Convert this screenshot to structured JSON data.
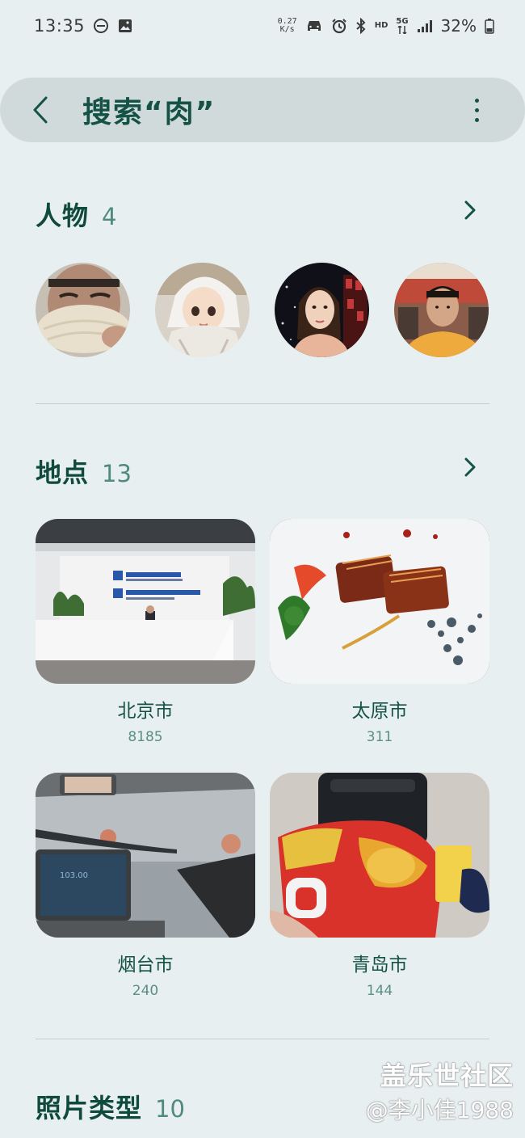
{
  "status_bar": {
    "time": "13:35",
    "net_speed_value": "0.27",
    "net_speed_unit": "K/s",
    "hd_label": "HD",
    "network_label": "5G",
    "battery": "32%",
    "icons": [
      "do-not-disturb-icon",
      "gallery-icon",
      "car-icon",
      "alarm-icon",
      "bluetooth-icon",
      "signal-icon",
      "battery-icon"
    ]
  },
  "search": {
    "title": "搜索“肉”"
  },
  "people_section": {
    "title": "人物",
    "count": "4"
  },
  "places_section": {
    "title": "地点",
    "count": "13",
    "places": [
      {
        "name": "北京市",
        "count": "8185"
      },
      {
        "name": "太原市",
        "count": "311"
      },
      {
        "name": "烟台市",
        "count": "240"
      },
      {
        "name": "青岛市",
        "count": "144"
      }
    ]
  },
  "photo_types_section": {
    "title": "照片类型",
    "count": "10"
  },
  "watermark": {
    "line1": "盖乐世社区",
    "line2": "@李小佳1988"
  },
  "colors": {
    "background": "#e8eff0",
    "search_bar": "#d1dadb",
    "accent_text": "#0f4a3c",
    "count_text": "#4f8a7e"
  }
}
